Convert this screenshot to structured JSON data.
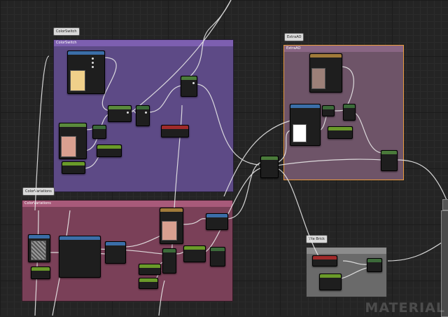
{
  "comments": {
    "color_switch": {
      "bubble": "ColorSwitch",
      "title": "ColorSwitch"
    },
    "extra_ao": {
      "bubble": "ExtraAO",
      "title": "ExtraAO"
    },
    "color_variations": {
      "bubble": "ColorVariations",
      "title": "ColorVariations"
    },
    "tile_brick": {
      "bubble": "Tile Brick",
      "title": "Tile Brick"
    }
  },
  "watermark": "MATERIAL",
  "colors": {
    "purple_comment": "#5d4a86",
    "purple_bar": "#7d5fb0",
    "pink_comment": "#7a4058",
    "pink_bar": "#a85a7a",
    "mauve_comment": "#6e5468",
    "mauve_bar": "#8a6684",
    "grey_comment": "#6a6a6a",
    "grey_bar": "#8c8c8c",
    "selected_outline": "#e89a3c"
  }
}
